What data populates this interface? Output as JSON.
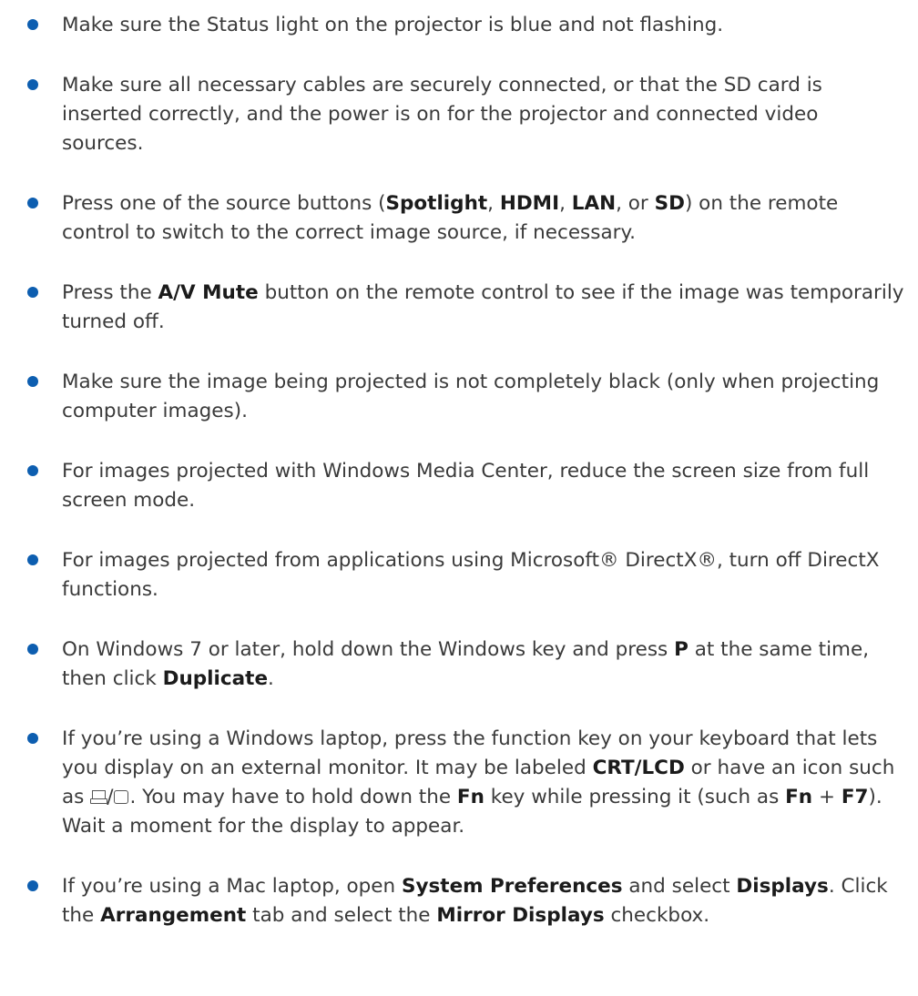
{
  "items": [
    {
      "text": "Make sure the Status light on the projector is blue and not flashing."
    },
    {
      "text": "Make sure all necessary cables are securely connected, or that the SD card is inserted correctly, and the power is on for the projector and connected video sources."
    },
    {
      "t1": "Press one of the source buttons (",
      "b1": "Spotlight",
      "t2": ", ",
      "b2": "HDMI",
      "t3": ", ",
      "b3": "LAN",
      "t4": ", or ",
      "b4": "SD",
      "t5": ") on the remote control to switch to the correct image source, if necessary."
    },
    {
      "t1": "Press the ",
      "b1": "A/V Mute",
      "t2": " button on the remote control to see if the image was temporarily turned off."
    },
    {
      "text": "Make sure the image being projected is not completely black (only when projecting computer images)."
    },
    {
      "text": "For images projected with Windows Media Center, reduce the screen size from full screen mode."
    },
    {
      "text": "For images projected from applications using Microsoft® DirectX®, turn off DirectX functions."
    },
    {
      "t1": "On Windows 7 or later, hold down the Windows key and press ",
      "b1": "P",
      "t2": " at the same time, then click ",
      "b2": "Duplicate",
      "t3": "."
    },
    {
      "t1": "If you’re using a Windows laptop, press the function key on your keyboard that lets you display on an external monitor. It may be labeled ",
      "b1": "CRT/LCD",
      "t2": " or have an icon such as ",
      "slash": "/",
      "t3": ". You may have to hold down the ",
      "b2": "Fn",
      "t4": " key while pressing it (such as ",
      "b3": "Fn",
      "t5": " + ",
      "b4": "F7",
      "t6": "). Wait a moment for the display to appear."
    },
    {
      "t1": "If you’re using a Mac laptop, open ",
      "b1": "System Preferences",
      "t2": " and select ",
      "b2": "Displays",
      "t3": ". Click the ",
      "b3": "Arrangement",
      "t4": " tab and select the ",
      "b4": "Mirror Displays",
      "t5": " checkbox."
    }
  ],
  "colors": {
    "bullet": "#0d5eb0",
    "text": "#3a3a3a"
  },
  "icons": [
    "laptop-icon",
    "monitor-icon"
  ]
}
